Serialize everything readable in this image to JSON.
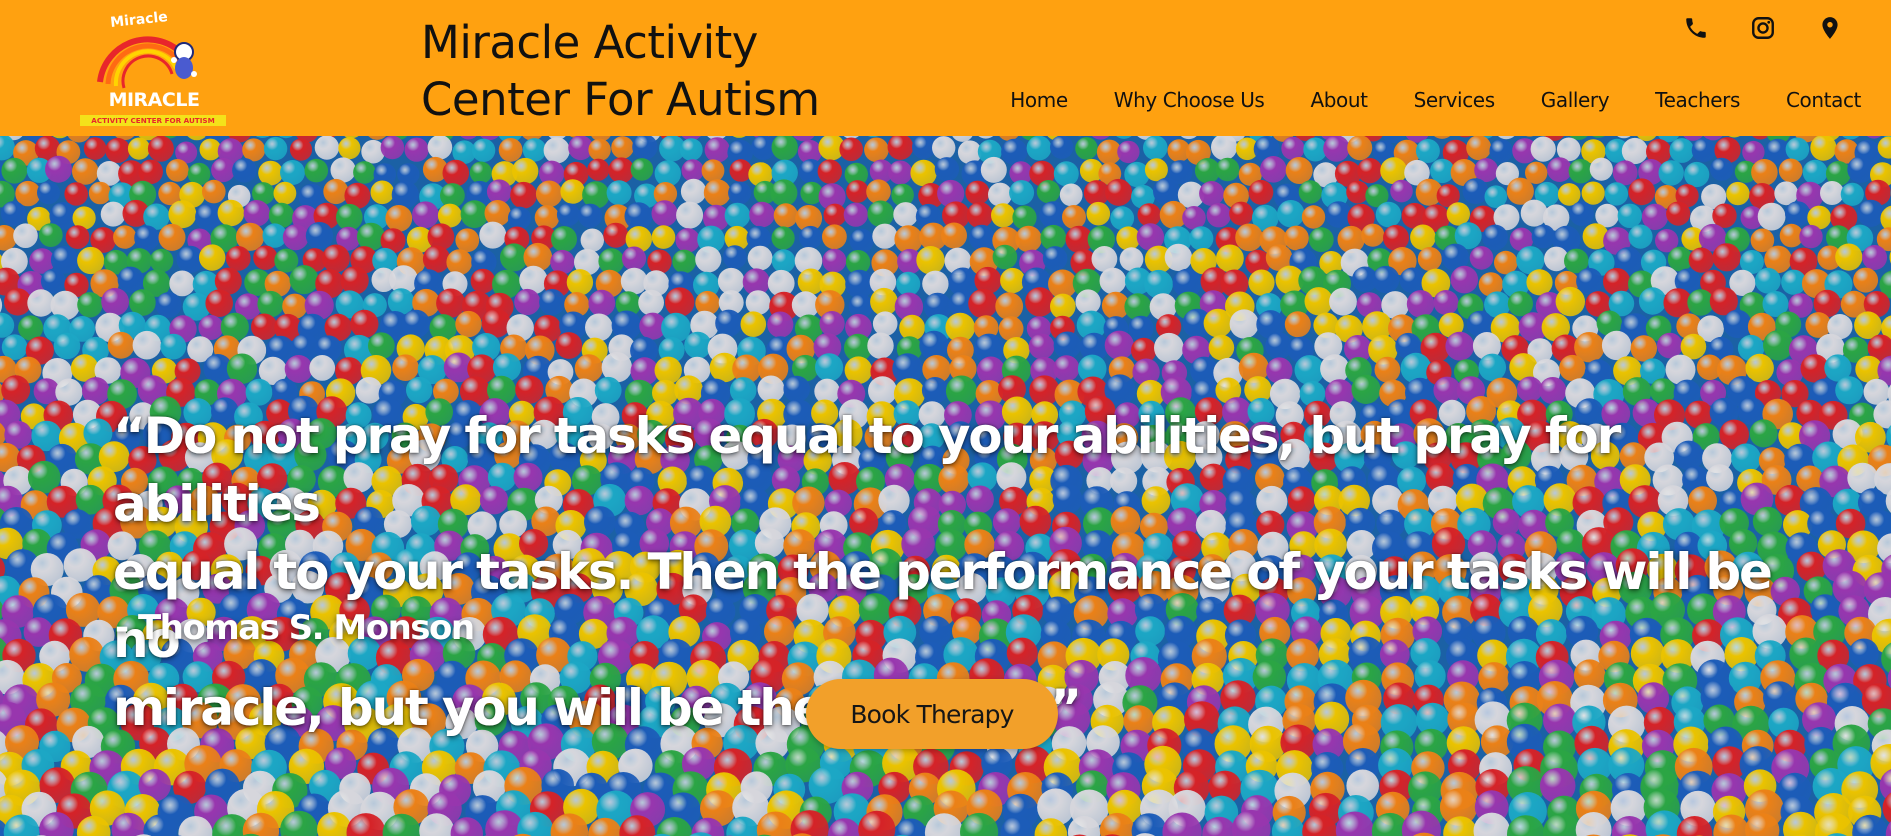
{
  "header": {
    "logo": {
      "arc_text": "Miracle",
      "name": "MIRACLE",
      "tagline": "ACTIVITY CENTER FOR AUTISM"
    },
    "site_title_line1": "Miracle Activity",
    "site_title_line2": "Center For Autism",
    "contact_icons": [
      "phone-icon",
      "instagram-icon",
      "map-pin-icon"
    ],
    "nav": [
      {
        "label": "Home"
      },
      {
        "label": "Why Choose Us"
      },
      {
        "label": "About"
      },
      {
        "label": "Services"
      },
      {
        "label": "Gallery"
      },
      {
        "label": "Teachers"
      },
      {
        "label": "Contact"
      }
    ]
  },
  "hero": {
    "background": "colorful ball pit",
    "quote_line1": "“Do not pray for tasks equal to your abilities, but pray for abilities",
    "quote_line2": "equal to your tasks. Then the performance of your tasks will be no",
    "quote_line3": "miracle, but you will be the miracle.”",
    "author": "- Thomas S. Monson",
    "cta_label": "Book Therapy"
  },
  "colors": {
    "header_bg": "#ffa110",
    "cta_bg": "#f2a02a",
    "text_dark": "#111111",
    "hero_text": "#ffffff",
    "ball_colors": [
      "#e8262b",
      "#ffd400",
      "#1f64c8",
      "#1fb6d6",
      "#2fb34a",
      "#a53bbd",
      "#ff8c1a",
      "#e9e9ef"
    ]
  }
}
